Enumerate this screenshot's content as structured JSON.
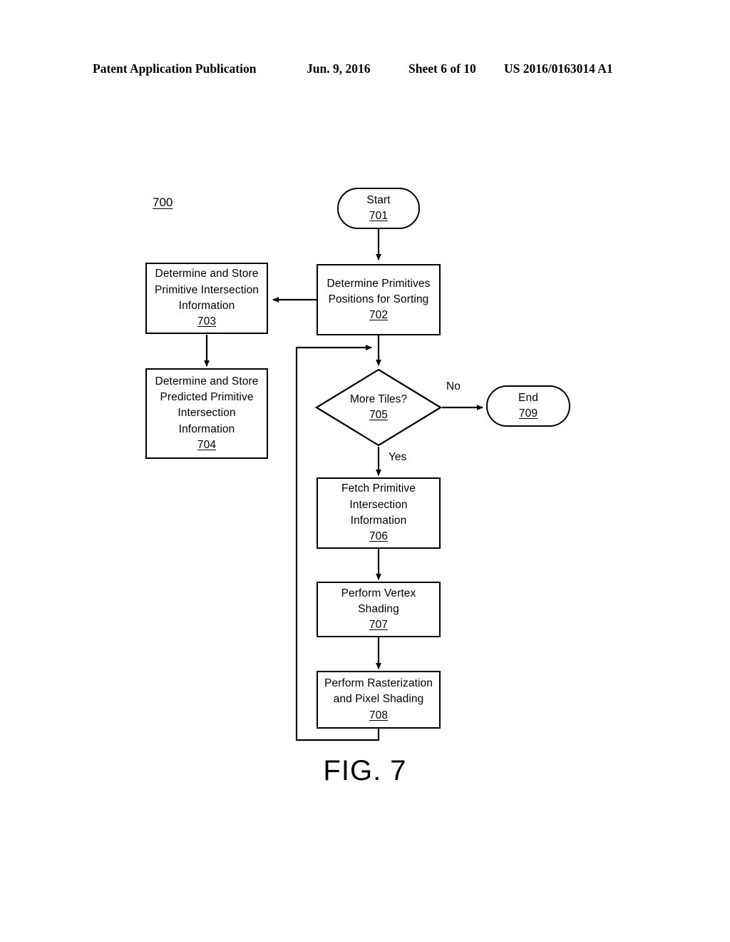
{
  "header": {
    "publication": "Patent Application Publication",
    "date": "Jun. 9, 2016",
    "sheet": "Sheet 6 of 10",
    "patent_number": "US 2016/0163014 A1"
  },
  "figure": {
    "caption": "FIG. 7",
    "diagram_ref": "700"
  },
  "flowchart": {
    "type": "flowchart",
    "nodes": [
      {
        "id": "701",
        "shape": "terminator",
        "lines": [
          "Start"
        ],
        "ref": "701"
      },
      {
        "id": "702",
        "shape": "process",
        "lines": [
          "Determine Primitives",
          "Positions for Sorting"
        ],
        "ref": "702"
      },
      {
        "id": "703",
        "shape": "process",
        "lines": [
          "Determine and Store",
          "Primitive Intersection",
          "Information"
        ],
        "ref": "703"
      },
      {
        "id": "704",
        "shape": "process",
        "lines": [
          "Determine and Store",
          "Predicted Primitive",
          "Intersection",
          "Information"
        ],
        "ref": "704"
      },
      {
        "id": "705",
        "shape": "decision",
        "lines": [
          "More Tiles?"
        ],
        "ref": "705"
      },
      {
        "id": "706",
        "shape": "process",
        "lines": [
          "Fetch Primitive",
          "Intersection",
          "Information"
        ],
        "ref": "706"
      },
      {
        "id": "707",
        "shape": "process",
        "lines": [
          "Perform Vertex",
          "Shading"
        ],
        "ref": "707"
      },
      {
        "id": "708",
        "shape": "process",
        "lines": [
          "Perform Rasterization",
          "and Pixel Shading"
        ],
        "ref": "708"
      },
      {
        "id": "709",
        "shape": "terminator",
        "lines": [
          "End"
        ],
        "ref": "709"
      }
    ],
    "edges": [
      {
        "from": "701",
        "to": "702",
        "label": ""
      },
      {
        "from": "702",
        "to": "703",
        "label": ""
      },
      {
        "from": "703",
        "to": "704",
        "label": ""
      },
      {
        "from": "702",
        "to": "705",
        "label": ""
      },
      {
        "from": "705",
        "to": "709",
        "label": "No"
      },
      {
        "from": "705",
        "to": "706",
        "label": "Yes"
      },
      {
        "from": "706",
        "to": "707",
        "label": ""
      },
      {
        "from": "707",
        "to": "708",
        "label": ""
      },
      {
        "from": "708",
        "to": "705",
        "label": ""
      }
    ],
    "labels": {
      "no": "No",
      "yes": "Yes"
    }
  },
  "colors": {
    "ink": "#000000",
    "paper": "#ffffff"
  }
}
